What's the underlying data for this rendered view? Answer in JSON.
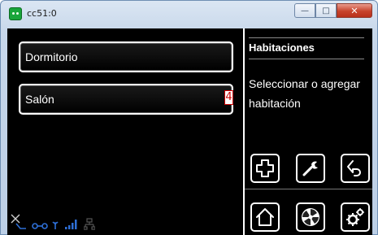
{
  "window": {
    "title": "cc51:0",
    "minimize_icon": "minimize-icon",
    "maximize_icon": "maximize-icon",
    "close_icon": "close-icon"
  },
  "rooms": [
    {
      "label": "Dormitorio"
    },
    {
      "label": "Salón",
      "badge": "4"
    }
  ],
  "panel": {
    "title": "Habitaciones",
    "instructions": "Seleccionar o agregar habitación"
  },
  "toolbar": [
    {
      "icon": "add-icon"
    },
    {
      "icon": "wrench-icon"
    },
    {
      "icon": "back-icon"
    }
  ],
  "nav": [
    {
      "icon": "home-icon"
    },
    {
      "icon": "fan-icon"
    },
    {
      "icon": "gears-icon"
    }
  ],
  "status_icons": [
    "expand-icon",
    "network-icon",
    "link-icon",
    "antenna-icon",
    "signal-bars-icon",
    "lan-icon"
  ],
  "colors": {
    "background": "#000000",
    "foreground": "#ffffff",
    "badge": "#cc0000",
    "status_blue": "#2e6fd6"
  }
}
